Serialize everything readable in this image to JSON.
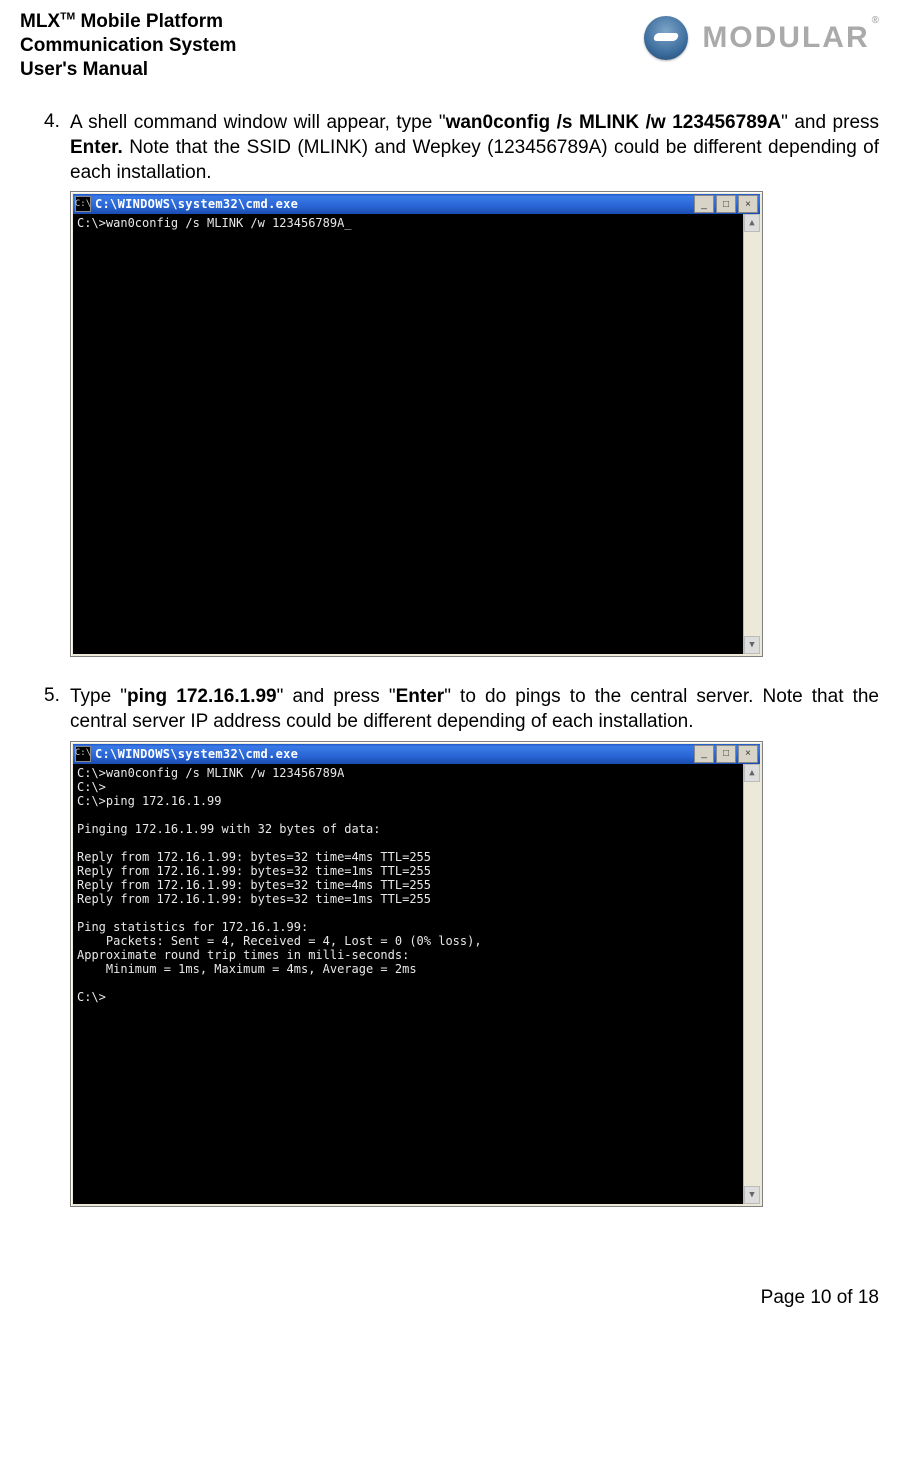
{
  "header": {
    "product_prefix": "MLX",
    "tm": "TM",
    "product_rest": " Mobile Platform",
    "line2": "Communication System",
    "line3": "User's Manual",
    "brand_word": "MODULAR",
    "reg": "®"
  },
  "step4": {
    "num": "4.",
    "t1": "A shell command window will appear, type \"",
    "b1": "wan0config /s MLINK /w 123456789A",
    "t2": "\" and press ",
    "b2": "Enter.",
    "t3": " Note that the SSID (MLINK) and Wepkey (123456789A) could be different depending of each installation."
  },
  "console1": {
    "title": "C:\\WINDOWS\\system32\\cmd.exe",
    "lines": [
      "C:\\>wan0config /s MLINK /w 123456789A_"
    ]
  },
  "step5": {
    "num": "5.",
    "t1": "Type \"",
    "b1": "ping 172.16.1.99",
    "t2": "\" and press \"",
    "b2": "Enter",
    "t3": "\" to do pings to the central server. Note that the central server IP address could be different depending of each installation."
  },
  "console2": {
    "title": "C:\\WINDOWS\\system32\\cmd.exe",
    "lines": [
      "C:\\>wan0config /s MLINK /w 123456789A",
      "C:\\>",
      "C:\\>ping 172.16.1.99",
      "",
      "Pinging 172.16.1.99 with 32 bytes of data:",
      "",
      "Reply from 172.16.1.99: bytes=32 time=4ms TTL=255",
      "Reply from 172.16.1.99: bytes=32 time=1ms TTL=255",
      "Reply from 172.16.1.99: bytes=32 time=4ms TTL=255",
      "Reply from 172.16.1.99: bytes=32 time=1ms TTL=255",
      "",
      "Ping statistics for 172.16.1.99:",
      "    Packets: Sent = 4, Received = 4, Lost = 0 (0% loss),",
      "Approximate round trip times in milli-seconds:",
      "    Minimum = 1ms, Maximum = 4ms, Average = 2ms",
      "",
      "C:\\>"
    ]
  },
  "win_buttons": {
    "min": "_",
    "max": "□",
    "close": "×"
  },
  "scroll_arrows": {
    "up": "▲",
    "down": "▼"
  },
  "cmd_icon_label": "C:\\",
  "footer": "Page 10 of 18"
}
